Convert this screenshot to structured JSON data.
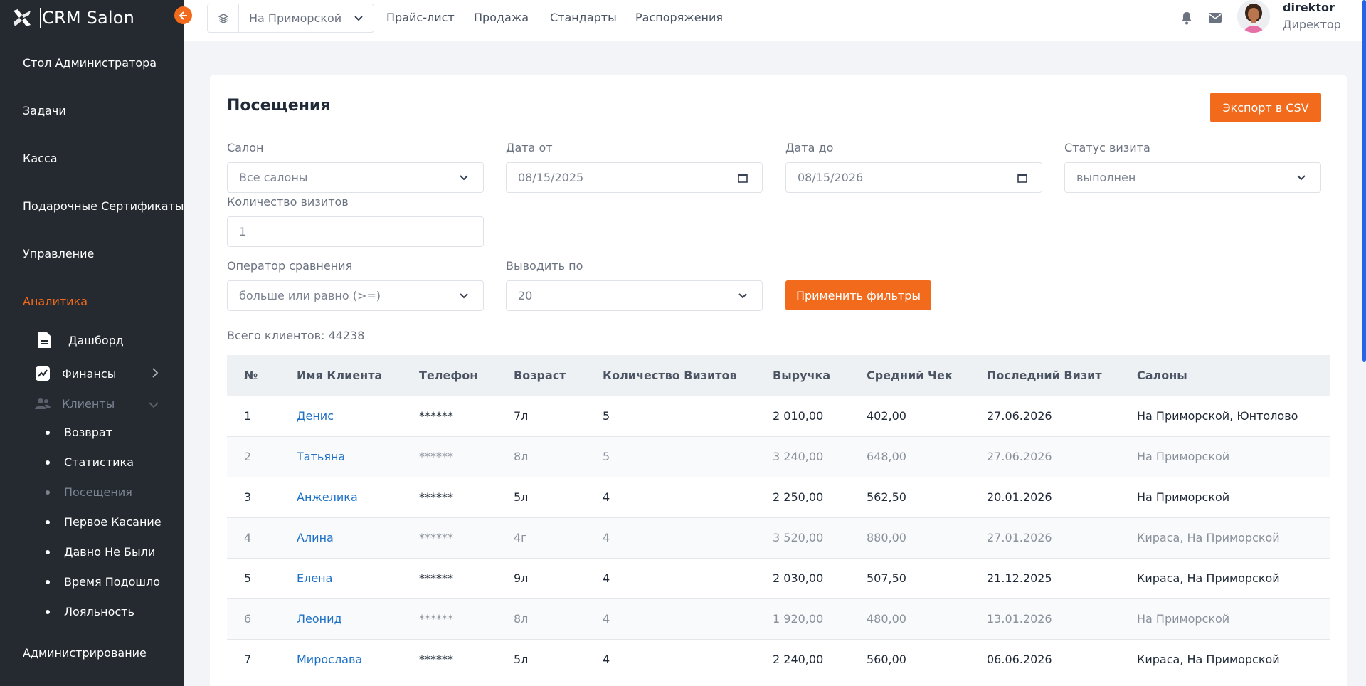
{
  "app": {
    "title": "CRM Salon"
  },
  "sidebar": {
    "items": [
      {
        "label": "Стол Администратора"
      },
      {
        "label": "Задачи"
      },
      {
        "label": "Касса"
      },
      {
        "label": "Подарочные Сертификаты"
      },
      {
        "label": "Управление"
      },
      {
        "label": "Аналитика"
      },
      {
        "label": "Администрирование"
      }
    ],
    "analytics": [
      {
        "label": "Дашборд"
      },
      {
        "label": "Финансы"
      },
      {
        "label": "Клиенты"
      }
    ],
    "clients": [
      {
        "label": "Возврат"
      },
      {
        "label": "Статистика"
      },
      {
        "label": "Посещения"
      },
      {
        "label": "Первое Касание"
      },
      {
        "label": "Давно Не Были"
      },
      {
        "label": "Время Подошло"
      },
      {
        "label": "Лояльность"
      }
    ]
  },
  "header": {
    "salon_select": "На Приморской",
    "links": [
      "Прайс-лист",
      "Продажа",
      "Стандарты",
      "Распоряжения"
    ],
    "user": {
      "name": "direktor",
      "role": "Директор"
    }
  },
  "page": {
    "title": "Посещения",
    "export_label": "Экспорт в CSV",
    "filters": {
      "salon_label": "Салон",
      "salon_value": "Все салоны",
      "date_from_label": "Дата от",
      "date_from_value": "08/15/2025",
      "date_to_label": "Дата до",
      "date_to_value": "08/15/2026",
      "status_label": "Статус визита",
      "status_value": "выполнен",
      "visits_label": "Количество визитов",
      "visits_value": "1",
      "operator_label": "Оператор сравнения",
      "operator_value": "больше или равно (>=)",
      "per_page_label": "Выводить по",
      "per_page_value": "20",
      "apply_label": "Применить фильтры"
    },
    "total": "Всего клиентов: 44238"
  },
  "table": {
    "headers": [
      "№",
      "Имя Клиента",
      "Телефон",
      "Возраст",
      "Количество Визитов",
      "Выручка",
      "Средний Чек",
      "Последний Визит",
      "Салоны"
    ],
    "rows": [
      [
        "1",
        "Денис",
        "******",
        "7л",
        "5",
        "2 010,00",
        "402,00",
        "27.06.2026",
        "На Приморской, Юнтолово"
      ],
      [
        "2",
        "Татьяна",
        "******",
        "8л",
        "5",
        "3 240,00",
        "648,00",
        "27.06.2026",
        "На Приморской"
      ],
      [
        "3",
        "Анжелика",
        "******",
        "5л",
        "4",
        "2 250,00",
        "562,50",
        "20.01.2026",
        "На Приморской"
      ],
      [
        "4",
        "Алина",
        "******",
        "4г",
        "4",
        "3 520,00",
        "880,00",
        "27.01.2026",
        "Кираса, На Приморской"
      ],
      [
        "5",
        "Елена",
        "******",
        "9л",
        "4",
        "2 030,00",
        "507,50",
        "21.12.2025",
        "Кираса, На Приморской"
      ],
      [
        "6",
        "Леонид",
        "******",
        "8л",
        "4",
        "1 920,00",
        "480,00",
        "13.01.2026",
        "На Приморской"
      ],
      [
        "7",
        "Мирослава",
        "******",
        "5л",
        "4",
        "2 240,00",
        "560,00",
        "06.06.2026",
        "Кираса, На Приморской"
      ]
    ]
  },
  "colors": {
    "accent": "#f26a1b",
    "sidebar": "#252a31",
    "link": "#1d70c7"
  }
}
